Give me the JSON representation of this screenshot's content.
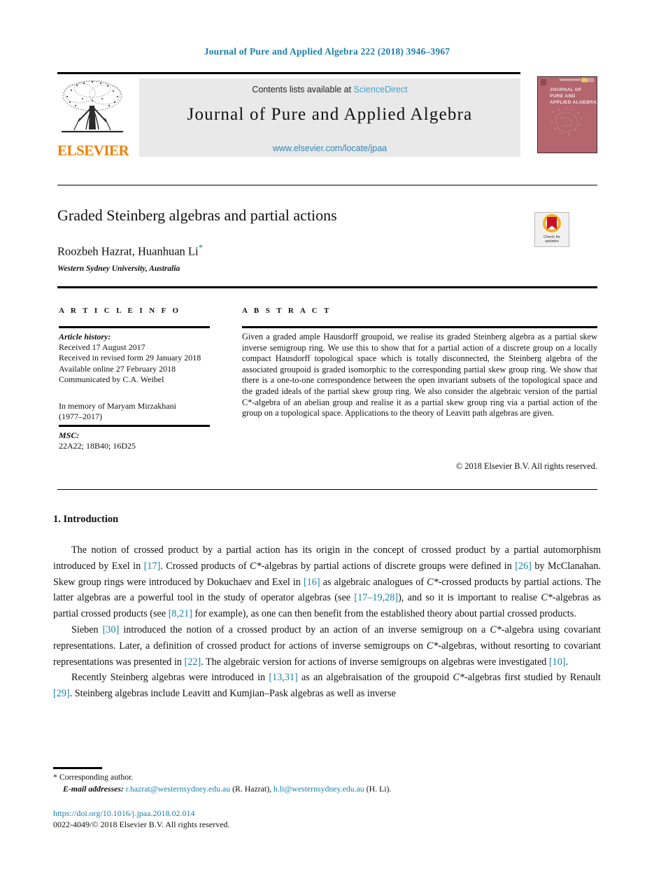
{
  "running_head": "Journal of Pure and Applied Algebra 222 (2018) 3946–3967",
  "masthead": {
    "contents_prefix": "Contents lists available at ",
    "sciencedirect": "ScienceDirect",
    "journal_name": "Journal of Pure and Applied Algebra",
    "journal_url": "www.elsevier.com/locate/jpaa",
    "publisher_wordmark": "ELSEVIER",
    "cover_title_lines": [
      "JOURNAL OF",
      "PURE AND",
      "APPLIED ALGEBRA"
    ],
    "cover_color": "#b4656e",
    "link_color": "#2f86b5",
    "brand_orange": "#F08000"
  },
  "article": {
    "title": "Graded Steinberg algebras and partial actions",
    "authors": "Roozbeh Hazrat, Huanhuan Li",
    "author_footnote_marker": "*",
    "affiliation": "Western Sydney University, Australia",
    "crossmark_label_line1": "Check for",
    "crossmark_label_line2": "updates"
  },
  "columns": {
    "info_heading": "A R T I C L E   I N F O",
    "abstract_heading": "A B S T R A C T"
  },
  "article_info": {
    "history_label": "Article history:",
    "history_lines": [
      "Received 17 August 2017",
      "Received in revised form 29 January 2018",
      "Available online 27 February 2018",
      "Communicated by C.A. Weibel"
    ],
    "memorial_lines": [
      "In memory of Maryam Mirzakhani",
      "(1977–2017)"
    ],
    "msc_label": "MSC:",
    "msc_codes": "22A22; 18B40; 16D25"
  },
  "abstract": {
    "text": "Given a graded ample Hausdorff groupoid, we realise its graded Steinberg algebra as a partial skew inverse semigroup ring. We use this to show that for a partial action of a discrete group on a locally compact Hausdorff topological space which is totally disconnected, the Steinberg algebra of the associated groupoid is graded isomorphic to the corresponding partial skew group ring. We show that there is a one-to-one correspondence between the open invariant subsets of the topological space and the graded ideals of the partial skew group ring. We also consider the algebraic version of the partial C*-algebra of an abelian group and realise it as a partial skew group ring via a partial action of the group on a topological space. Applications to the theory of Leavitt path algebras are given.",
    "copyright": "© 2018 Elsevier B.V. All rights reserved."
  },
  "body": {
    "section_number_title": "1. Introduction",
    "paragraph1_parts": {
      "a": "The notion of crossed product by a partial action has its origin in the concept of crossed product by a partial automorphism introduced by Exel in ",
      "c1": "[17]",
      "b": ". Crossed products of ",
      "m1": "C*",
      "c": "-algebras by partial actions of discrete groups were defined in ",
      "c2": "[26]",
      "d": " by McClanahan. Skew group rings were introduced by Dokuchaev and Exel in ",
      "c3": "[16]",
      "e": " as algebraic analogues of ",
      "m2": "C*",
      "f": "-crossed products by partial actions. The latter algebras are a powerful tool in the study of operator algebras (see ",
      "c4": "[17–19,28]",
      "g": "), and so it is important to realise ",
      "m3": "C*",
      "h": "-algebras as partial crossed products (see ",
      "c5": "[8,21]",
      "i": " for example), as one can then benefit from the established theory about partial crossed products."
    },
    "paragraph2_parts": {
      "a": "Sieben ",
      "c1": "[30]",
      "b": " introduced the notion of a crossed product by an action of an inverse semigroup on a ",
      "m1": "C*",
      "c": "-algebra using covariant representations. Later, a definition of crossed product for actions of inverse semigroups on ",
      "m2": "C*",
      "d": "-algebras, without resorting to covariant representations was presented in ",
      "c2": "[22]",
      "e": ". The algebraic version for actions of inverse semigroups on algebras were investigated ",
      "c3": "[10]",
      "f": "."
    },
    "paragraph3_parts": {
      "a": "Recently Steinberg algebras were introduced in ",
      "c1": "[13,31]",
      "b": " as an algebraisation of the groupoid ",
      "m1": "C*",
      "c": "-algebras first studied by Renault ",
      "c2": "[29]",
      "d": ". Steinberg algebras include Leavitt and Kumjian–Pask algebras as well as inverse"
    }
  },
  "footer": {
    "corresponding_marker": "*",
    "corresponding_text": "Corresponding author.",
    "email_label": "E-mail addresses:",
    "email1": "r.hazrat@westernsydney.edu.au",
    "email1_owner": "(R. Hazrat),",
    "email2": "h.li@westernsydney.edu.au",
    "email2_owner": "(H. Li).",
    "doi": "https://doi.org/10.1016/j.jpaa.2018.02.014",
    "issn_line": "0022-4049/© 2018 Elsevier B.V. All rights reserved."
  }
}
